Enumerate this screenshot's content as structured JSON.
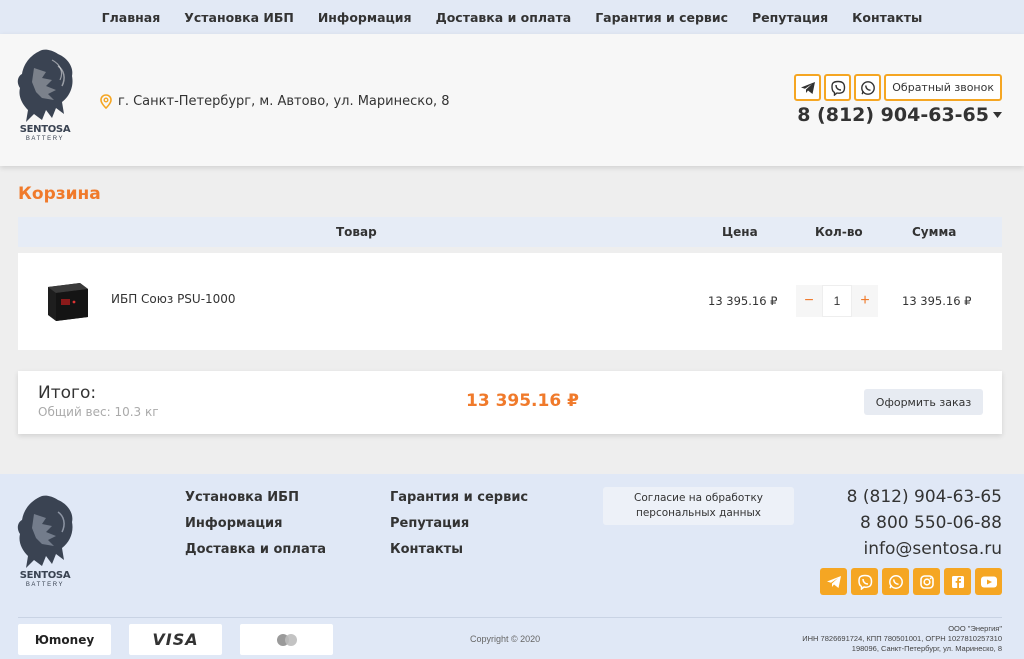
{
  "topnav": {
    "items": [
      {
        "label": "Главная"
      },
      {
        "label": "Установка ИБП"
      },
      {
        "label": "Информация"
      },
      {
        "label": "Доставка и оплата"
      },
      {
        "label": "Гарантия и сервис"
      },
      {
        "label": "Репутация"
      },
      {
        "label": "Контакты"
      }
    ]
  },
  "header": {
    "brand": "SENTOSA",
    "brand_sub": "BATTERY",
    "address": "г. Санкт-Петербург, м. Автово, ул. Маринеско, 8",
    "callback_label": "Обратный звонок",
    "phone": "8 (812) 904-63-65",
    "icons": [
      "telegram-icon",
      "viber-icon",
      "whatsapp-icon"
    ]
  },
  "cart": {
    "title": "Корзина",
    "columns": {
      "product": "Товар",
      "price": "Цена",
      "qty": "Кол-во",
      "sum": "Сумма"
    },
    "items": [
      {
        "name": "ИБП Союз PSU-1000",
        "price": "13 395.16 ₽",
        "qty": "1",
        "sum": "13 395.16 ₽"
      }
    ],
    "minus": "−",
    "plus": "+",
    "total_label": "Итого:",
    "weight": "Общий вес: 10.3 кг",
    "total_sum": "13 395.16 ₽",
    "order_button": "Оформить заказ"
  },
  "footer": {
    "brand": "SENTOSA",
    "brand_sub": "BATTERY",
    "col1": [
      "Установка ИБП",
      "Информация",
      "Доставка и оплата"
    ],
    "col2": [
      "Гарантия и сервис",
      "Репутация",
      "Контакты"
    ],
    "consent": "Согласие на обработку персональных данных",
    "phones": [
      "8 (812) 904-63-65",
      "8 800 550-06-88"
    ],
    "email": "info@sentosa.ru",
    "social_icons": [
      "telegram-icon",
      "viber-icon",
      "whatsapp-icon",
      "instagram-icon",
      "facebook-icon",
      "youtube-icon"
    ],
    "payments": [
      "Юmoney",
      "VISA",
      "MasterCard"
    ],
    "copyright": "Copyright © 2020",
    "legal": [
      "ООО \"Энергия\"",
      "ИНН 7826691724, КПП 780501001, ОГРН 1027810257310",
      "198096, Санкт-Петербург, ул. Маринеско, 8"
    ]
  },
  "colors": {
    "accent": "#f07a2b",
    "icon_border": "#f5a623",
    "nav_bg": "#e2e9f5",
    "footer_bg": "#e0e8f6"
  }
}
